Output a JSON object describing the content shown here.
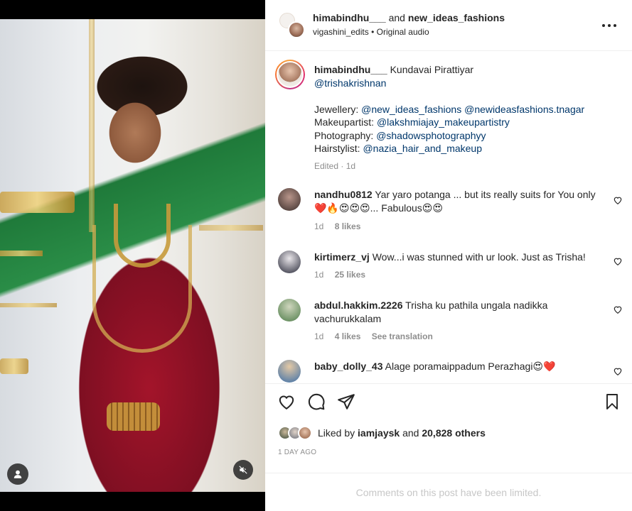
{
  "header": {
    "author": "himabindhu___",
    "joiner": "and",
    "collaborator": "new_ideas_fashions",
    "subline_user": "vigashini_edits",
    "subline_sep": "•",
    "subline_audio": "Original audio",
    "more_icon": "more-horizontal-icon"
  },
  "caption": {
    "username": "himabindhu___",
    "title": "Kundavai Pirattiyar",
    "mention_line": "@trishakrishnan",
    "jewellery_label": "Jewellery:",
    "jewellery_links": "@new_ideas_fashions @newideasfashions.tnagar",
    "makeup_label": "Makeupartist:",
    "makeup_link": "@lakshmiajay_makeupartistry",
    "photo_label": "Photography:",
    "photo_link": "@shadowsphotographyy",
    "hair_label": "Hairstylist:",
    "hair_link": "@nazia_hair_and_makeup",
    "edited": "Edited · 1d"
  },
  "comments": [
    {
      "username": "nandhu0812",
      "text_line1": "Yar yaro potanga ... but its really suits for You only",
      "text_line2": "❤️🔥😍😍😍... Fabulous😍😍",
      "age": "1d",
      "likes": "8 likes",
      "avatar_color": "#3a2d2a"
    },
    {
      "username": "kirtimerz_vj",
      "text_line1": "Wow...i was stunned with ur look. Just as Trisha!",
      "age": "1d",
      "likes": "25 likes",
      "avatar_color": "#5b5b6b"
    },
    {
      "username": "abdul.hakkim.2226",
      "text_line1": "Trisha ku pathila ungala nadikka",
      "text_line2": "vachurukkalam",
      "age": "1d",
      "likes": "4 likes",
      "translate": "See translation",
      "avatar_color": "#4f7d4a"
    },
    {
      "username": "baby_dolly_43",
      "text_line1": "Alage poramaippadum Perazhagi😍❤️",
      "avatar_color": "#3d6fa8"
    }
  ],
  "likes": {
    "prefix": "Liked by",
    "user": "iamjaysk",
    "joiner": "and",
    "others": "20,828 others"
  },
  "timestamp": "1 DAY AGO",
  "comments_limited": "Comments on this post have been limited.",
  "colors": {
    "link": "#00376b",
    "muted": "#8e8e8e",
    "story_ring": "#e1306c"
  }
}
